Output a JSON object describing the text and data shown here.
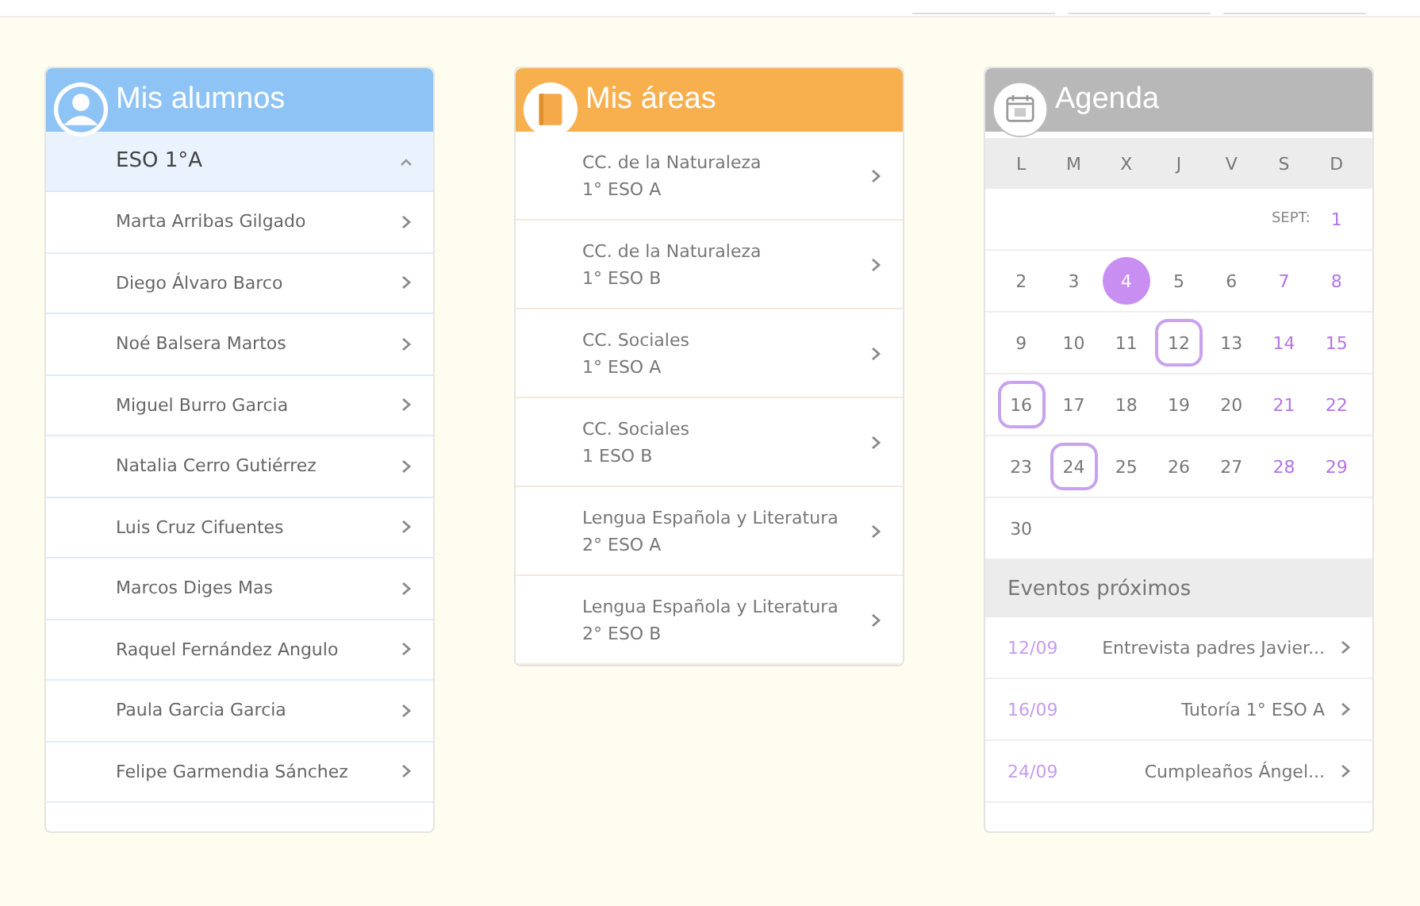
{
  "students_panel": {
    "title": "Mis alumnos",
    "group": {
      "label": "ESO 1°A",
      "expanded": true
    },
    "students": [
      "Marta Arribas Gilgado",
      "Diego Álvaro Barco",
      "Noé Balsera Martos",
      "Miguel Burro Garcia",
      "Natalia Cerro Gutiérrez",
      "Luis Cruz Cifuentes",
      "Marcos Diges Mas",
      "Raquel Fernández Angulo",
      "Paula Garcia Garcia",
      "Felipe Garmendia Sánchez"
    ]
  },
  "areas_panel": {
    "title": "Mis áreas",
    "areas": [
      {
        "subject": "CC. de la Naturaleza",
        "group": "1° ESO A"
      },
      {
        "subject": "CC. de la Naturaleza",
        "group": "1° ESO B"
      },
      {
        "subject": "CC. Sociales",
        "group": "1° ESO A"
      },
      {
        "subject": "CC. Sociales",
        "group": "1 ESO B"
      },
      {
        "subject": "Lengua Española y Literatura",
        "group": "2° ESO A"
      },
      {
        "subject": "Lengua Española y Literatura",
        "group": "2° ESO B"
      }
    ]
  },
  "agenda_panel": {
    "title": "Agenda",
    "weekdays": [
      "L",
      "M",
      "X",
      "J",
      "V",
      "S",
      "D"
    ],
    "weeks": [
      [
        {
          "kind": "month",
          "text": "SEPT:"
        },
        {
          "kind": "day",
          "text": "1",
          "weekend": true,
          "today": false,
          "event": false
        }
      ],
      [
        {
          "kind": "day",
          "text": "2",
          "weekend": false,
          "today": false,
          "event": false
        },
        {
          "kind": "day",
          "text": "3",
          "weekend": false,
          "today": false,
          "event": false
        },
        {
          "kind": "day",
          "text": "4",
          "weekend": false,
          "today": true,
          "event": false
        },
        {
          "kind": "day",
          "text": "5",
          "weekend": false,
          "today": false,
          "event": false
        },
        {
          "kind": "day",
          "text": "6",
          "weekend": false,
          "today": false,
          "event": false
        },
        {
          "kind": "day",
          "text": "7",
          "weekend": true,
          "today": false,
          "event": false
        },
        {
          "kind": "day",
          "text": "8",
          "weekend": true,
          "today": false,
          "event": false
        }
      ],
      [
        {
          "kind": "day",
          "text": "9",
          "weekend": false,
          "today": false,
          "event": false
        },
        {
          "kind": "day",
          "text": "10",
          "weekend": false,
          "today": false,
          "event": false
        },
        {
          "kind": "day",
          "text": "11",
          "weekend": false,
          "today": false,
          "event": false
        },
        {
          "kind": "day",
          "text": "12",
          "weekend": false,
          "today": false,
          "event": true
        },
        {
          "kind": "day",
          "text": "13",
          "weekend": false,
          "today": false,
          "event": false
        },
        {
          "kind": "day",
          "text": "14",
          "weekend": true,
          "today": false,
          "event": false
        },
        {
          "kind": "day",
          "text": "15",
          "weekend": true,
          "today": false,
          "event": false
        }
      ],
      [
        {
          "kind": "day",
          "text": "16",
          "weekend": false,
          "today": false,
          "event": true
        },
        {
          "kind": "day",
          "text": "17",
          "weekend": false,
          "today": false,
          "event": false
        },
        {
          "kind": "day",
          "text": "18",
          "weekend": false,
          "today": false,
          "event": false
        },
        {
          "kind": "day",
          "text": "19",
          "weekend": false,
          "today": false,
          "event": false
        },
        {
          "kind": "day",
          "text": "20",
          "weekend": false,
          "today": false,
          "event": false
        },
        {
          "kind": "day",
          "text": "21",
          "weekend": true,
          "today": false,
          "event": false
        },
        {
          "kind": "day",
          "text": "22",
          "weekend": true,
          "today": false,
          "event": false
        }
      ],
      [
        {
          "kind": "day",
          "text": "23",
          "weekend": false,
          "today": false,
          "event": false
        },
        {
          "kind": "day",
          "text": "24",
          "weekend": false,
          "today": false,
          "event": true
        },
        {
          "kind": "day",
          "text": "25",
          "weekend": false,
          "today": false,
          "event": false
        },
        {
          "kind": "day",
          "text": "26",
          "weekend": false,
          "today": false,
          "event": false
        },
        {
          "kind": "day",
          "text": "27",
          "weekend": false,
          "today": false,
          "event": false
        },
        {
          "kind": "day",
          "text": "28",
          "weekend": true,
          "today": false,
          "event": false
        },
        {
          "kind": "day",
          "text": "29",
          "weekend": true,
          "today": false,
          "event": false
        }
      ],
      [
        {
          "kind": "day",
          "text": "30",
          "weekend": false,
          "today": false,
          "event": false
        }
      ]
    ],
    "events_heading": "Eventos próximos",
    "events": [
      {
        "date": "12/09",
        "title": "Entrevista padres Javier..."
      },
      {
        "date": "16/09",
        "title": "Tutoría 1° ESO A"
      },
      {
        "date": "24/09",
        "title": "Cumpleaños Ángel..."
      }
    ]
  }
}
